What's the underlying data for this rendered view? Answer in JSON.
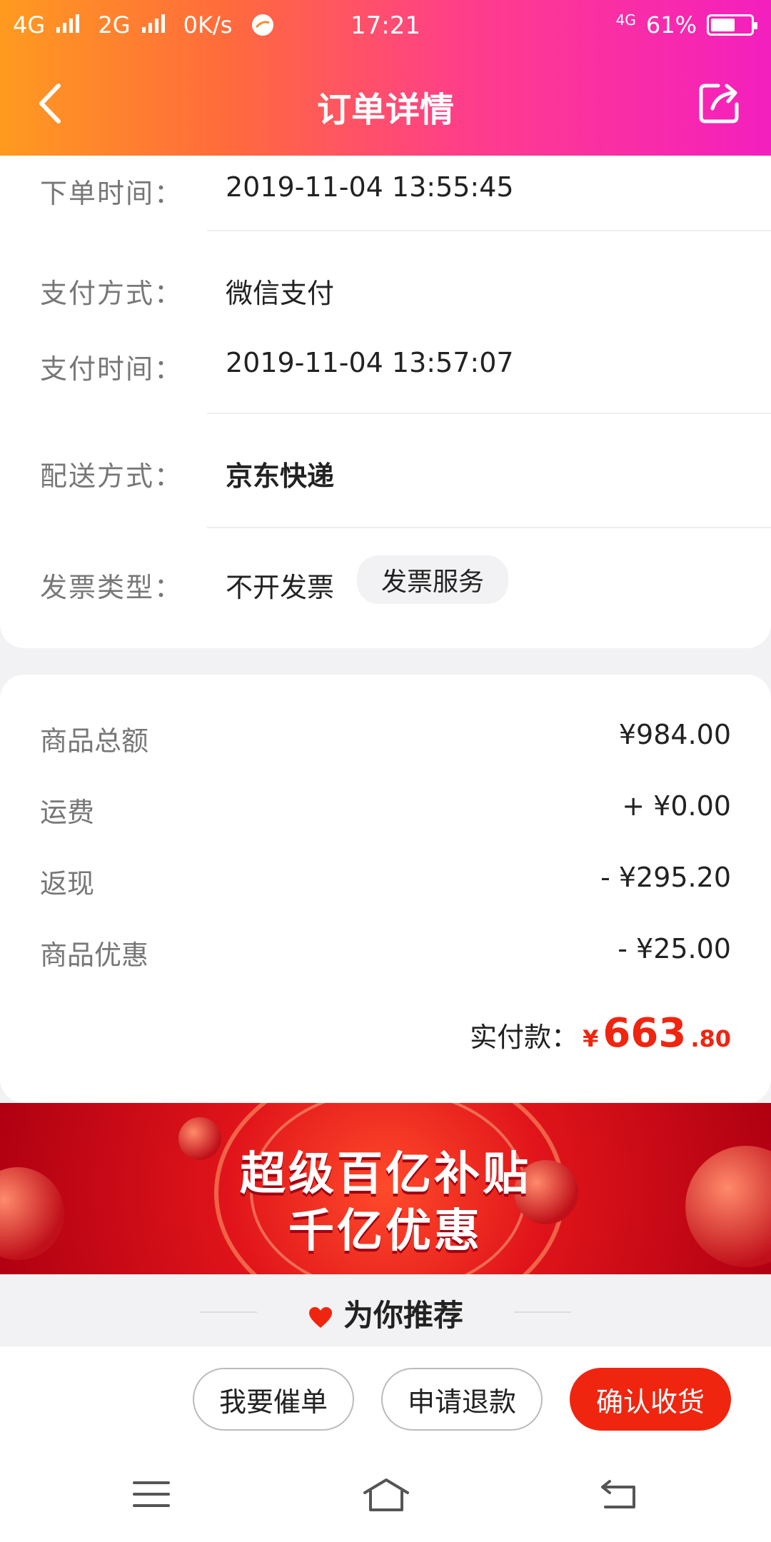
{
  "status_bar": {
    "network1": "4G",
    "network2": "2G",
    "speed": "0K/s",
    "time": "17:21",
    "battery_network": "4G",
    "battery_percent": "61%",
    "battery_level": 0.61
  },
  "header": {
    "title": "订单详情",
    "back_icon": "chevron-left-icon",
    "share_icon": "share-icon"
  },
  "order_info": {
    "order_time": {
      "label": "下单时间：",
      "value": "2019-11-04 13:55:45"
    },
    "pay_method": {
      "label": "支付方式：",
      "value": "微信支付"
    },
    "pay_time": {
      "label": "支付时间：",
      "value": "2019-11-04 13:57:07"
    },
    "delivery": {
      "label": "配送方式：",
      "value": "京东快递"
    },
    "invoice": {
      "label": "发票类型：",
      "value": "不开发票",
      "service_label": "发票服务"
    }
  },
  "price": {
    "goods_total": {
      "label": "商品总额",
      "value": "¥984.00"
    },
    "shipping": {
      "label": "运费",
      "value": "+ ¥0.00"
    },
    "cashback": {
      "label": "返现",
      "value": "- ¥295.20"
    },
    "discount": {
      "label": "商品优惠",
      "value": "- ¥25.00"
    },
    "paid": {
      "label": "实付款：",
      "currency": "¥",
      "integer": "663",
      "decimal": ".80"
    },
    "accent_color": "#f0250f"
  },
  "banner": {
    "line1": "超级百亿补贴",
    "line2": "千亿优惠"
  },
  "recommend": {
    "title": "为你推荐",
    "icon": "heart-icon"
  },
  "actions": {
    "remind": "我要催单",
    "refund": "申请退款",
    "confirm": "确认收货"
  },
  "system_nav": {
    "menu_icon": "menu-icon",
    "home_icon": "home-icon",
    "back_icon": "back-icon"
  }
}
